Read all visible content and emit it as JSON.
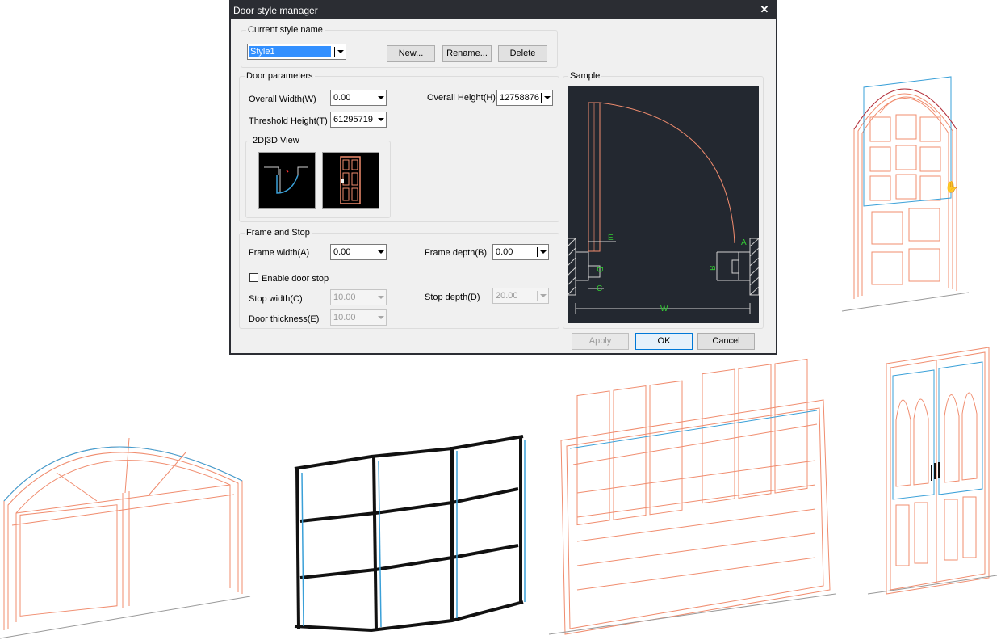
{
  "dialog": {
    "title": "Door style manager",
    "close_glyph": "✕",
    "current_style": {
      "group_label": "Current style name",
      "style_value": "Style1",
      "new_label": "New...",
      "rename_label": "Rename...",
      "delete_label": "Delete"
    },
    "door_parameters": {
      "group_label": "Door parameters",
      "overall_width_label": "Overall Width(W)",
      "overall_width_value": "0.00",
      "overall_height_label": "Overall Height(H)",
      "overall_height_value": "12758876",
      "threshold_height_label": "Threshold Height(T)",
      "threshold_height_value": "61295719",
      "view_group_label": "2D|3D View"
    },
    "frame_stop": {
      "group_label": "Frame and Stop",
      "frame_width_label": "Frame width(A)",
      "frame_width_value": "0.00",
      "frame_depth_label": "Frame depth(B)",
      "frame_depth_value": "0.00",
      "enable_stop_label": "Enable door stop",
      "stop_width_label": "Stop width(C)",
      "stop_width_value": "10.00",
      "stop_depth_label": "Stop depth(D)",
      "stop_depth_value": "20.00",
      "door_thickness_label": "Door thickness(E)",
      "door_thickness_value": "10.00"
    },
    "sample": {
      "group_label": "Sample",
      "dim_labels": {
        "A": "A",
        "B": "B",
        "C": "C",
        "D": "D",
        "E": "E",
        "W": "W"
      }
    },
    "buttons": {
      "apply_label": "Apply",
      "ok_label": "OK",
      "cancel_label": "Cancel"
    }
  },
  "colors": {
    "title_bar": "#2b2d33",
    "sample_bg": "#232830",
    "door_line": "#f08c6e",
    "dim_green": "#33cc33",
    "frame_cyan": "#3aa0d8",
    "dark_panel": "#111111"
  },
  "icons": {
    "dropdown": "chevron-down-icon",
    "close": "close-icon"
  }
}
